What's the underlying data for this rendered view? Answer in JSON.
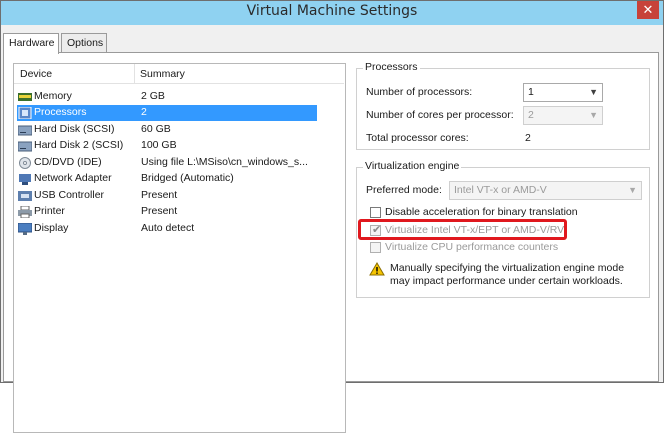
{
  "window": {
    "title": "Virtual Machine Settings",
    "close_glyph": "✕"
  },
  "tabs": [
    {
      "label": "Hardware",
      "active": true
    },
    {
      "label": "Options",
      "active": false
    }
  ],
  "device_list": {
    "col_device": "Device",
    "col_summary": "Summary",
    "rows": [
      {
        "device": "Memory",
        "summary": "2 GB",
        "icon": "memory-icon"
      },
      {
        "device": "Processors",
        "summary": "2",
        "icon": "processor-icon",
        "selected": true
      },
      {
        "device": "Hard Disk (SCSI)",
        "summary": "60 GB",
        "icon": "hard-disk-icon"
      },
      {
        "device": "Hard Disk 2 (SCSI)",
        "summary": "100 GB",
        "icon": "hard-disk-icon"
      },
      {
        "device": "CD/DVD (IDE)",
        "summary": "Using file L:\\MSiso\\cn_windows_s...",
        "icon": "cd-dvd-icon"
      },
      {
        "device": "Network Adapter",
        "summary": "Bridged (Automatic)",
        "icon": "network-adapter-icon"
      },
      {
        "device": "USB Controller",
        "summary": "Present",
        "icon": "usb-controller-icon"
      },
      {
        "device": "Printer",
        "summary": "Present",
        "icon": "printer-icon"
      },
      {
        "device": "Display",
        "summary": "Auto detect",
        "icon": "display-icon"
      }
    ]
  },
  "processors": {
    "group_label": "Processors",
    "num_processors_label": "Number of processors:",
    "num_processors_value": "1",
    "cores_label": "Number of cores per processor:",
    "cores_value": "2",
    "total_label": "Total processor cores:",
    "total_value": "2"
  },
  "virtualization": {
    "group_label": "Virtualization engine",
    "mode_label": "Preferred mode:",
    "mode_value": "Intel VT-x or AMD-V",
    "disable_accel_label": "Disable acceleration for binary translation",
    "vtx_label": "Virtualize Intel VT-x/EPT or AMD-V/RVI",
    "cpu_counters_label": "Virtualize CPU performance counters",
    "warning_line1": "Manually specifying the virtualization engine mode",
    "warning_line2": "may impact performance under certain workloads."
  },
  "colors": {
    "selection": "#3399ff",
    "titlebar": "#8fd2f1",
    "highlight": "#e0181e"
  }
}
